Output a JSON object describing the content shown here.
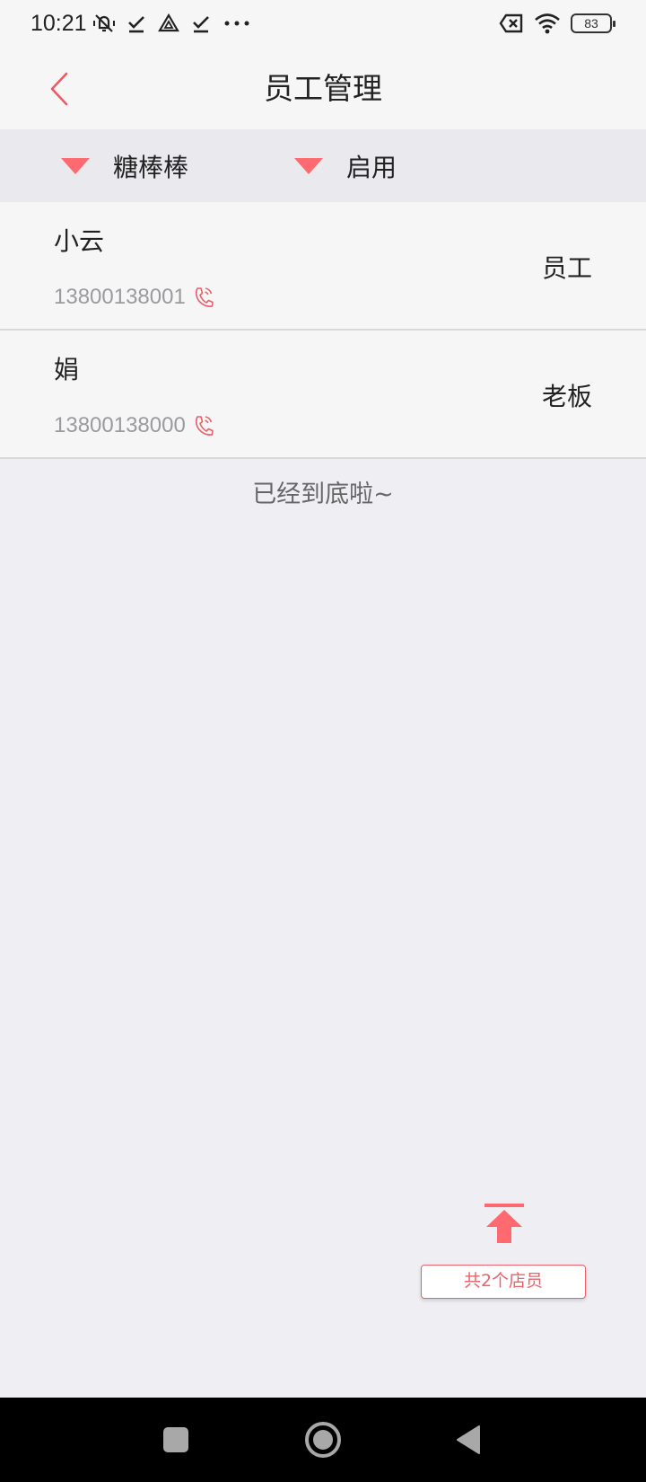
{
  "status_bar": {
    "time": "10:21",
    "battery": "83",
    "icons_left": [
      "mute-icon",
      "check-icon",
      "drive-icon",
      "check-icon",
      "more-dots-icon"
    ],
    "icons_right": [
      "sim-off-icon",
      "wifi-icon",
      "battery-icon"
    ]
  },
  "header": {
    "title": "员工管理",
    "back_icon": "chevron-left-icon"
  },
  "filters": {
    "shop": "糖棒棒",
    "status": "启用"
  },
  "employees": [
    {
      "name": "小云",
      "phone": "13800138001",
      "role": "员工"
    },
    {
      "name": "娟",
      "phone": "13800138000",
      "role": "老板"
    }
  ],
  "list_end_text": "已经到底啦~",
  "footer": {
    "count_text": "共2个店员"
  },
  "colors": {
    "accent": "#ff6a70",
    "accent_text": "#e9616a",
    "background": "#efeff3",
    "surface": "#f6f6f7"
  }
}
